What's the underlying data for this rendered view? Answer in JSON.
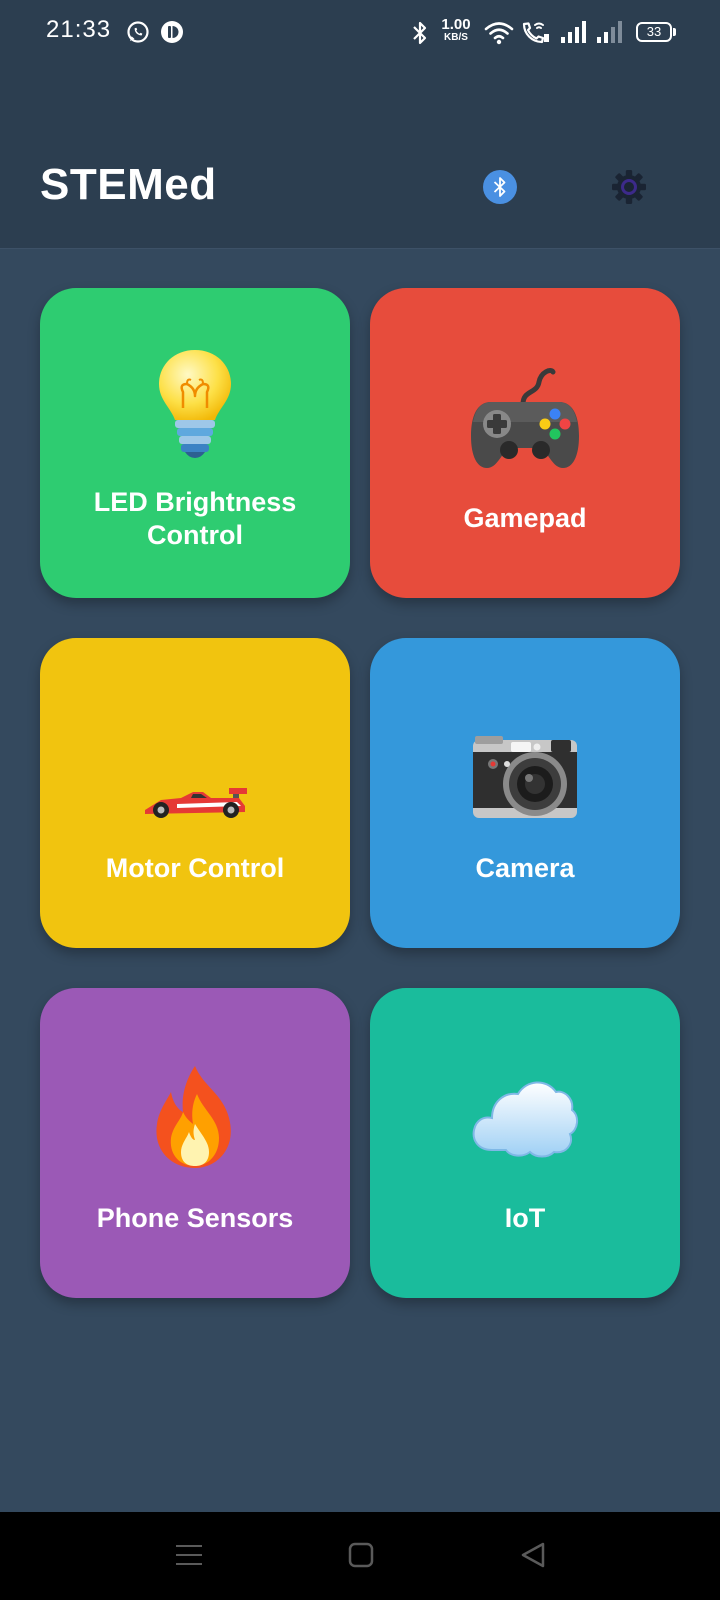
{
  "status_bar": {
    "time": "21:33",
    "net_speed_value": "1.00",
    "net_speed_unit": "KB/S",
    "battery": "33"
  },
  "header": {
    "title": "STEMed",
    "icons": [
      "bluetooth-icon",
      "gear-icon"
    ],
    "accent_bluetooth": "#4a90e2"
  },
  "tiles": [
    {
      "label": "LED Brightness Control",
      "icon": "light-bulb-icon",
      "color": "#2ecc71"
    },
    {
      "label": "Gamepad",
      "icon": "gamepad-icon",
      "color": "#e74c3c"
    },
    {
      "label": "Motor Control",
      "icon": "race-car-icon",
      "color": "#f1c40f"
    },
    {
      "label": "Camera",
      "icon": "camera-icon",
      "color": "#3498db"
    },
    {
      "label": "Phone Sensors",
      "icon": "fire-icon",
      "color": "#9b59b6"
    },
    {
      "label": "IoT",
      "icon": "cloud-icon",
      "color": "#1abc9c"
    }
  ],
  "colors": {
    "background": "#34495e",
    "header_background": "#2c3e50"
  }
}
